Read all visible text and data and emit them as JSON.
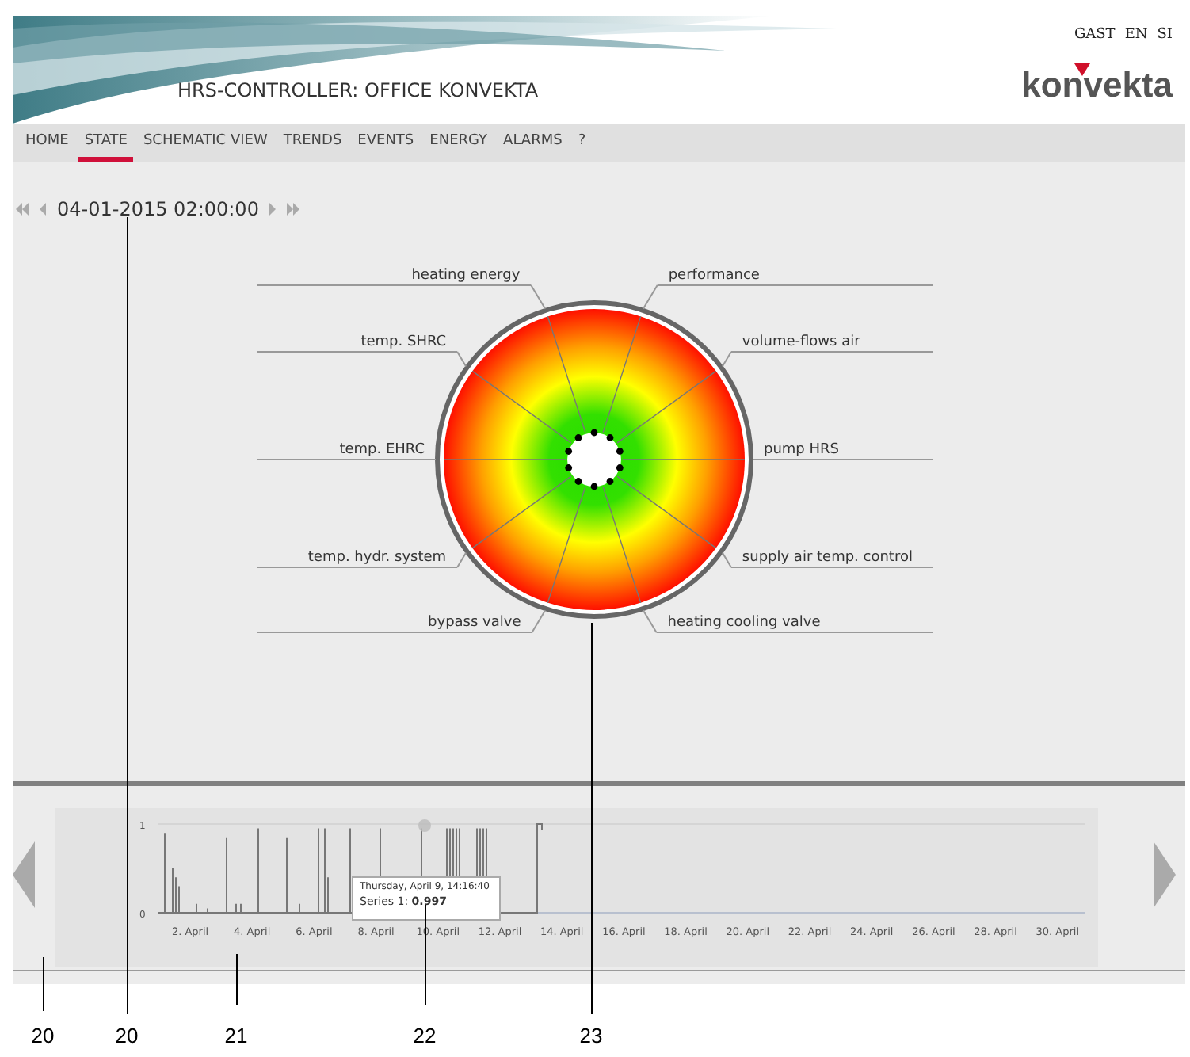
{
  "header": {
    "title": "HRS-CONTROLLER: OFFICE KONVEKTA",
    "languages": [
      {
        "label": "GAST"
      },
      {
        "label": "EN"
      },
      {
        "label": "SI"
      }
    ],
    "logo": "konvekta"
  },
  "nav": [
    {
      "label": "HOME",
      "selected": false
    },
    {
      "label": "STATE",
      "selected": true
    },
    {
      "label": "SCHEMATIC VIEW",
      "selected": false
    },
    {
      "label": "TRENDS",
      "selected": false
    },
    {
      "label": "EVENTS",
      "selected": false
    },
    {
      "label": "ENERGY",
      "selected": false
    },
    {
      "label": "ALARMS",
      "selected": false
    },
    {
      "label": "?",
      "selected": false
    }
  ],
  "date": "04-01-2015 02:00:00",
  "axes": [
    {
      "name": "heating energy"
    },
    {
      "name": "performance"
    },
    {
      "name": "temp. SHRC"
    },
    {
      "name": "volume-flows air"
    },
    {
      "name": "temp. EHRC"
    },
    {
      "name": "pump HRS"
    },
    {
      "name": "temp. hydr. system"
    },
    {
      "name": "supply air temp. control"
    },
    {
      "name": "bypass valve"
    },
    {
      "name": "heating cooling valve"
    }
  ],
  "trend": {
    "y_labels": [
      "1",
      "0"
    ],
    "x_labels": [
      "2. April",
      "4. April",
      "6. April",
      "8. April",
      "10. April",
      "12. April",
      "14. April",
      "16. April",
      "18. April",
      "20. April",
      "22. April",
      "24. April",
      "26. April",
      "28. April",
      "30. April"
    ],
    "tooltip": {
      "title": "Thursday, April 9, 14:16:40",
      "value": "Series 1: **0.997**"
    }
  },
  "callouts": [
    {
      "number": "20"
    },
    {
      "number": "20"
    },
    {
      "number": "21"
    },
    {
      "number": "22"
    },
    {
      "number": "23"
    }
  ]
}
